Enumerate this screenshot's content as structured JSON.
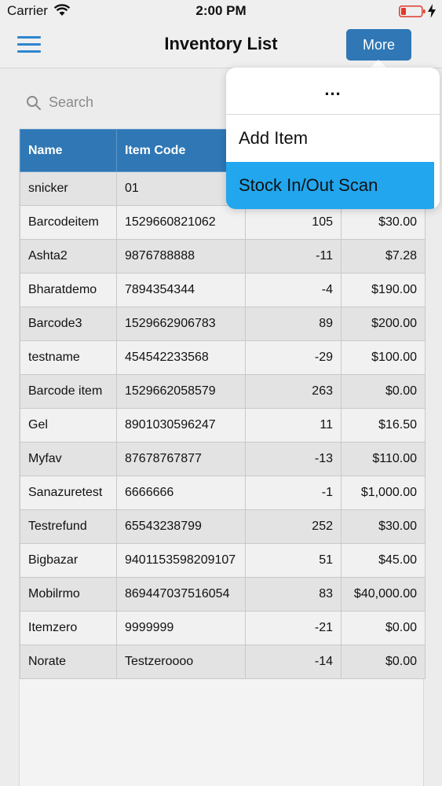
{
  "status_bar": {
    "carrier": "Carrier",
    "time": "2:00 PM",
    "battery_color": "#e0392b"
  },
  "nav": {
    "title": "Inventory List",
    "more_label": "More",
    "menu_icon": "hamburger-menu-icon",
    "accent_color": "#2f77b5"
  },
  "search": {
    "placeholder": "Search",
    "value": ""
  },
  "table": {
    "columns": [
      "Name",
      "Item Code",
      "",
      ""
    ],
    "rows": [
      [
        "snicker",
        "01",
        "",
        ""
      ],
      [
        "Barcodeitem",
        "1529660821062",
        "105",
        "$30.00"
      ],
      [
        "Ashta2",
        "9876788888",
        "-11",
        "$7.28"
      ],
      [
        "Bharatdemo",
        "7894354344",
        "-4",
        "$190.00"
      ],
      [
        "Barcode3",
        "1529662906783",
        "89",
        "$200.00"
      ],
      [
        "testname",
        "454542233568",
        "-29",
        "$100.00"
      ],
      [
        "Barcode item",
        "1529662058579",
        "263",
        "$0.00"
      ],
      [
        "Gel",
        "8901030596247",
        "11",
        "$16.50"
      ],
      [
        "Myfav",
        "87678767877",
        "-13",
        "$110.00"
      ],
      [
        "Sanazuretest",
        "6666666",
        "-1",
        "$1,000.00"
      ],
      [
        "Testrefund",
        "65543238799",
        "252",
        "$30.00"
      ],
      [
        "Bigbazar",
        "9401153598209107",
        "51",
        "$45.00"
      ],
      [
        "Mobilrmo",
        "869447037516054",
        "83",
        "$40,000.00"
      ],
      [
        "Itemzero",
        "9999999",
        "-21",
        "$0.00"
      ],
      [
        "Norate",
        "Testzeroooo",
        "-14",
        "$0.00"
      ]
    ]
  },
  "popover": {
    "header": "...",
    "items": [
      "Add Item",
      "Stock In/Out Scan"
    ],
    "highlight_color": "#22a6ee"
  }
}
